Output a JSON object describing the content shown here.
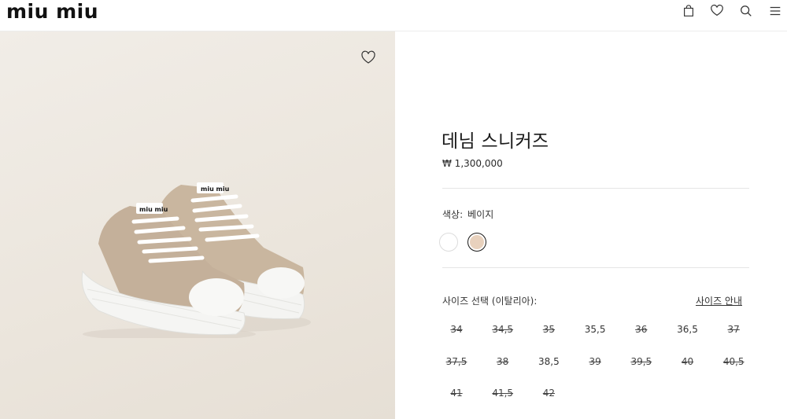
{
  "header": {
    "logo": "miu miu",
    "icons": [
      "bag-icon",
      "heart-icon",
      "search-icon",
      "menu-icon"
    ]
  },
  "product": {
    "title": "데님 스니커즈",
    "price": "₩ 1,300,000",
    "color_label": "색상:",
    "color_value": "베이지",
    "swatches": [
      {
        "name": "white",
        "color": "#ffffff"
      },
      {
        "name": "beige",
        "color": "#e8d1bd",
        "selected": true
      }
    ],
    "size_label": "사이즈 선택 (이탈리아):",
    "size_guide": "사이즈 안내",
    "sizes": [
      {
        "label": "34",
        "available": false
      },
      {
        "label": "34,5",
        "available": false
      },
      {
        "label": "35",
        "available": false
      },
      {
        "label": "35,5",
        "available": true
      },
      {
        "label": "36",
        "available": false
      },
      {
        "label": "36,5",
        "available": true
      },
      {
        "label": "37",
        "available": false
      },
      {
        "label": "37,5",
        "available": false
      },
      {
        "label": "38",
        "available": false
      },
      {
        "label": "38,5",
        "available": true
      },
      {
        "label": "39",
        "available": false
      },
      {
        "label": "39,5",
        "available": false
      },
      {
        "label": "40",
        "available": false
      },
      {
        "label": "40,5",
        "available": false
      },
      {
        "label": "41",
        "available": false
      },
      {
        "label": "41,5",
        "available": false
      },
      {
        "label": "42",
        "available": false
      }
    ]
  }
}
